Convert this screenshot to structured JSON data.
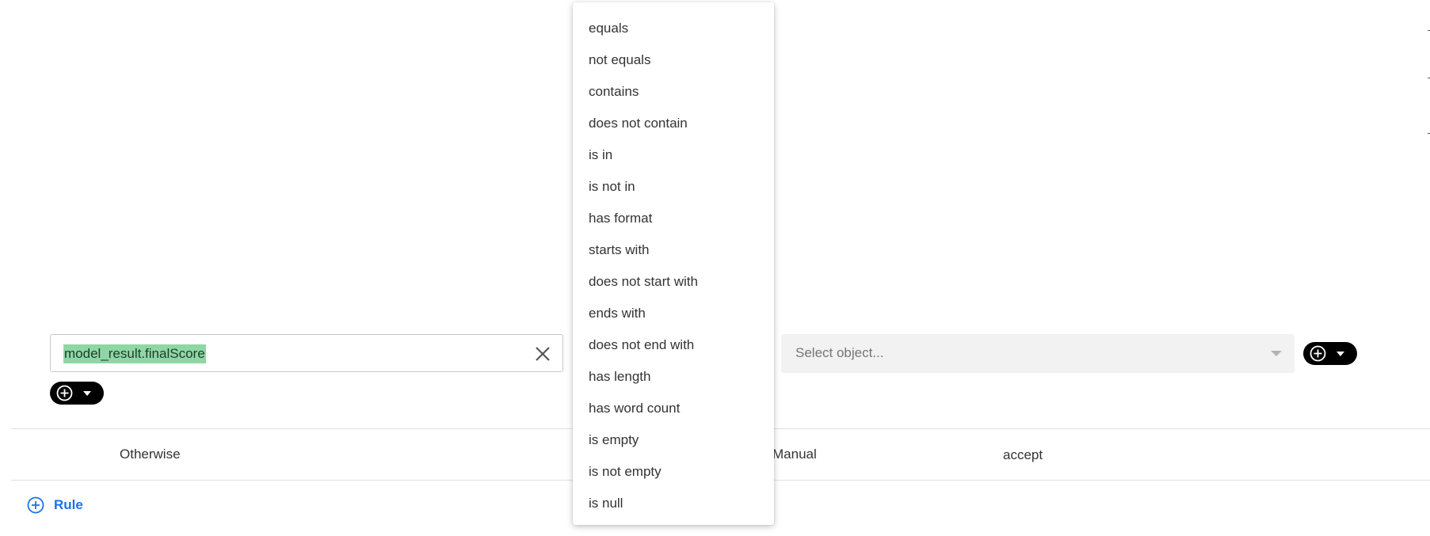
{
  "field": {
    "value": "model_result.finalScore"
  },
  "object_select": {
    "placeholder": "Select object..."
  },
  "otherwise_row": {
    "label": "Otherwise",
    "mode": "Manual",
    "action": "accept"
  },
  "add_rule": {
    "label": "Rule"
  },
  "operator_menu": {
    "items": [
      "equals",
      "not equals",
      "contains",
      "does not contain",
      "is in",
      "is not in",
      "has format",
      "starts with",
      "does not start with",
      "ends with",
      "does not end with",
      "has length",
      "has word count",
      "is empty",
      "is not empty",
      "is null"
    ]
  },
  "icons": {
    "clear": "close-icon",
    "add": "plus-circle-icon",
    "caret": "caret-down-icon"
  },
  "colors": {
    "highlight": "#8fd6a5",
    "link": "#1a73e8",
    "pill": "#000000"
  }
}
